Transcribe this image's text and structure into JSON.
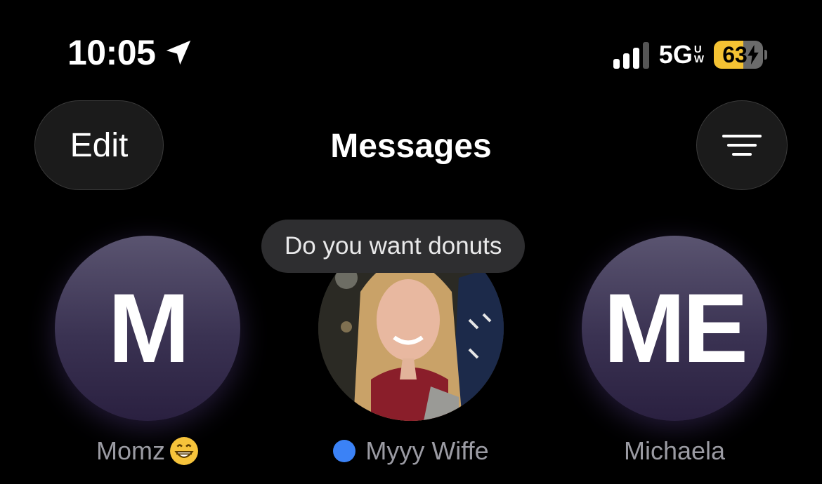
{
  "status_bar": {
    "time": "10:05",
    "network": "5G",
    "network_suffix_top": "U",
    "network_suffix_bottom": "W",
    "battery_level": "63",
    "battery_fraction": 0.63,
    "battery_color": "#f4c233",
    "charging": true,
    "signal_bars": 3,
    "signal_bars_total": 4
  },
  "header": {
    "edit_label": "Edit",
    "title": "Messages",
    "filter_icon": "filter-lines-icon"
  },
  "pinned": [
    {
      "initials": "M",
      "name": "Momz",
      "emoji": "grinning-face",
      "unread": false
    },
    {
      "name": "Myyy Wiffe",
      "unread": true,
      "unread_color": "#3b82f6",
      "bubble_text": "Do you want donuts"
    },
    {
      "initials": "ME",
      "name": "Michaela",
      "unread": false
    }
  ]
}
